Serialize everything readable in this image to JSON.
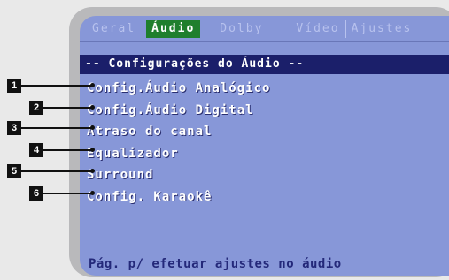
{
  "tabs": [
    {
      "label": "Geral",
      "active": false
    },
    {
      "label": "Áudio",
      "active": true
    },
    {
      "label": "Dolby",
      "active": false
    },
    {
      "label": "Vídeo",
      "active": false
    },
    {
      "label": "Ajustes",
      "active": false
    }
  ],
  "menu_title": "-- Configurações do Áudio --",
  "items": [
    {
      "label": "Config.Áudio Analógico",
      "callout": "1"
    },
    {
      "label": "Config.Áudio Digital",
      "callout": "2"
    },
    {
      "label": "Atraso do canal",
      "callout": "3"
    },
    {
      "label": "Equalizador",
      "callout": "4"
    },
    {
      "label": "Surround",
      "callout": "5"
    },
    {
      "label": "Config. Karaokê",
      "callout": "6"
    }
  ],
  "footer_hint": "Pág. p/ efetuar ajustes no áudio",
  "colors": {
    "screen_bg": "#8797d8",
    "active_tab": "#1f7f2d",
    "title_bar": "#1b1f6a",
    "footer_text": "#24297a",
    "bezel": "#b9b9bb"
  }
}
